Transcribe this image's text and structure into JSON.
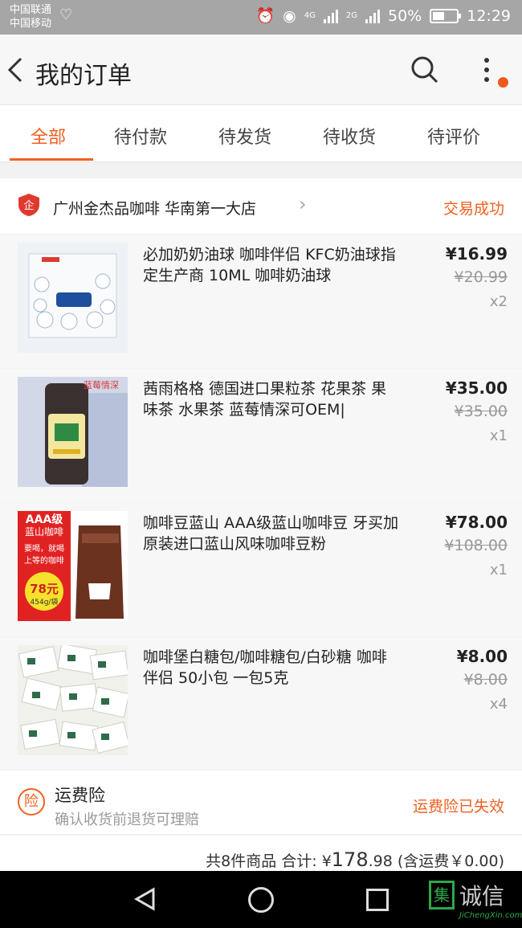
{
  "status_bar": {
    "carrier1": "中国联通",
    "carrier2": "中国移动",
    "net1": "4G",
    "net2": "2G",
    "battery": "50%",
    "time": "12:29"
  },
  "nav": {
    "title": "我的订单",
    "icons": [
      "back-arrow-icon",
      "search-icon",
      "more-vertical-icon"
    ]
  },
  "tabs": [
    {
      "label": "全部",
      "active": true
    },
    {
      "label": "待付款",
      "active": false
    },
    {
      "label": "待发货",
      "active": false
    },
    {
      "label": "待收货",
      "active": false
    },
    {
      "label": "待评价",
      "active": false
    }
  ],
  "order": {
    "shop_name": "广州金杰品咖啡 华南第一大店",
    "status": "交易成功",
    "items": [
      {
        "title": "必加奶奶油球 咖啡伴侣 KFC奶油球指定生产商 10ML 咖啡奶油球",
        "price": "¥16.99",
        "original_price": "¥20.99",
        "qty": "x2"
      },
      {
        "title": "茜雨格格 德国进口果粒茶 花果茶 果味茶 水果茶 蓝莓情深可OEM|",
        "price": "¥35.00",
        "original_price": "¥35.00",
        "qty": "x1",
        "image_text": "蓝莓情深"
      },
      {
        "title": "咖啡豆蓝山 AAA级蓝山咖啡豆 牙买加原装进口蓝山风味咖啡豆粉",
        "price": "¥78.00",
        "original_price": "¥108.00",
        "qty": "x1",
        "image_text": {
          "line1": "AAA级",
          "line2": "蓝山咖啡",
          "line3": "要喝，就喝",
          "line4": "上等的咖啡",
          "price": "78元",
          "weight": "454g/袋"
        }
      },
      {
        "title": "咖啡堡白糖包/咖啡糖包/白砂糖 咖啡伴侣 50小包 一包5克",
        "price": "¥8.00",
        "original_price": "¥8.00",
        "qty": "x4"
      }
    ]
  },
  "insurance": {
    "icon_text": "险",
    "title": "运费险",
    "desc": "确认收货前退货可理赔",
    "status": "运费险已失效"
  },
  "summary": {
    "count": "共8件商品",
    "total_label": "合计: ¥",
    "total_int": "178",
    "total_dec": ".98",
    "shipping": "(含运费￥0.00)"
  },
  "watermark": {
    "logo_char": "集",
    "text": "诚信",
    "url": "JiChengXin.com"
  },
  "colors": {
    "accent": "#f06020",
    "brand_red": "#e03a2f"
  }
}
